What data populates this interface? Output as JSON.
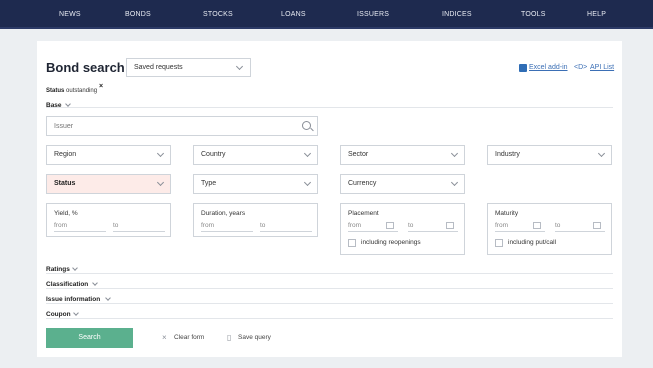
{
  "nav": [
    {
      "label": "NEWS"
    },
    {
      "label": "BONDS"
    },
    {
      "label": "STOCKS"
    },
    {
      "label": "LOANS"
    },
    {
      "label": "ISSUERS"
    },
    {
      "label": "INDICES"
    },
    {
      "label": "TOOLS"
    },
    {
      "label": "HELP"
    }
  ],
  "page": {
    "title": "Bond search",
    "saved_requests": "Saved requests",
    "excel_addin": "Excel add-in",
    "api_list": "API List",
    "api_icon": "<D>"
  },
  "status_filter": {
    "label": "Status",
    "value": "outstanding",
    "close": "×"
  },
  "sections": {
    "base": "Base",
    "ratings": "Ratings",
    "classification": "Classification",
    "issue_information": "Issue information",
    "coupon": "Coupon"
  },
  "issuer": {
    "placeholder": "Issuer"
  },
  "dropdowns": {
    "region": "Region",
    "country": "Country",
    "sector": "Sector",
    "industry": "Industry",
    "status": "Status",
    "type": "Type",
    "currency": "Currency"
  },
  "ranges": {
    "yield": {
      "label": "Yield, %",
      "from": "from",
      "to": "to"
    },
    "duration": {
      "label": "Duration, years",
      "from": "from",
      "to": "to"
    },
    "placement": {
      "label": "Placement",
      "from": "from",
      "to": "to",
      "checkbox": "including reopenings"
    },
    "maturity": {
      "label": "Maturity",
      "from": "from",
      "to": "to",
      "checkbox": "including put/call"
    }
  },
  "actions": {
    "search": "Search",
    "clear_form": "Clear form",
    "save_query": "Save query",
    "clear_icon": "×",
    "save_icon": "▯"
  },
  "colors": {
    "nav_bg": "#1e2a4f",
    "search_button": "#5bb08e",
    "link": "#3b6fb5",
    "status_highlight": "#fdebe8"
  }
}
